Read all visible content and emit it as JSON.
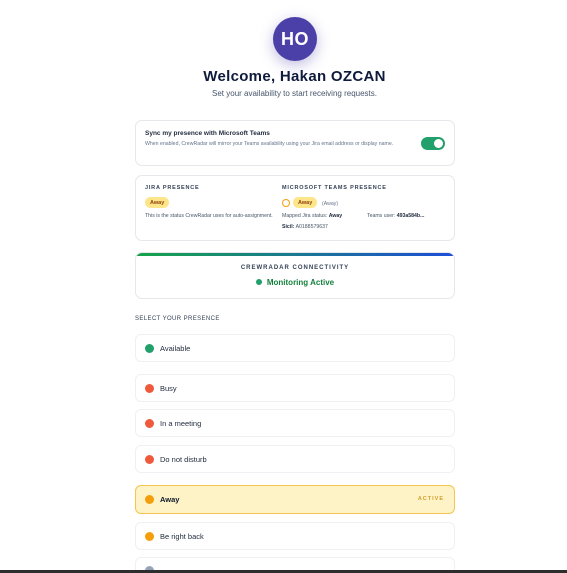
{
  "profile": {
    "initials": "HO",
    "avatar_color": "#4b3fa8",
    "welcome": "Welcome, Hakan OZCAN",
    "subtitle": "Set your availability to start receiving requests."
  },
  "sync": {
    "title": "Sync my presence with Microsoft Teams",
    "description": "When enabled, CrewRadar will mirror your Teams availability using your Jira email address or display name.",
    "enabled": true
  },
  "jira_presence": {
    "label": "JIRA PRESENCE",
    "status": "Away",
    "note": "This is the status CrewRadar uses for auto-assignment."
  },
  "teams_presence": {
    "label": "MICROSOFT TEAMS PRESENCE",
    "status": "Away",
    "status_paren": "(Away)",
    "mapped_label": "Mapped Jira status:",
    "mapped_value": "Away",
    "teams_user_label": "Teams user:",
    "teams_user_value": "493a584b...",
    "sicil_label": "Sicil:",
    "sicil_value": "A0188579637"
  },
  "connectivity": {
    "title": "CREWRADAR CONNECTIVITY",
    "status": "Monitoring Active",
    "status_color": "#22a06b"
  },
  "presence_select": {
    "label": "SELECT YOUR PRESENCE",
    "active_tag": "ACTIVE",
    "options": [
      {
        "label": "Available",
        "color": "#22a06b"
      },
      {
        "label": "Busy",
        "color": "#ef5a3c"
      },
      {
        "label": "In a meeting",
        "color": "#ef5a3c"
      },
      {
        "label": "Do not disturb",
        "color": "#ef5a3c"
      },
      {
        "label": "Away",
        "color": "#f59e0b",
        "active": true
      },
      {
        "label": "Be right back",
        "color": "#f59e0b"
      },
      {
        "label": "",
        "color": "#94a3b8"
      }
    ]
  }
}
